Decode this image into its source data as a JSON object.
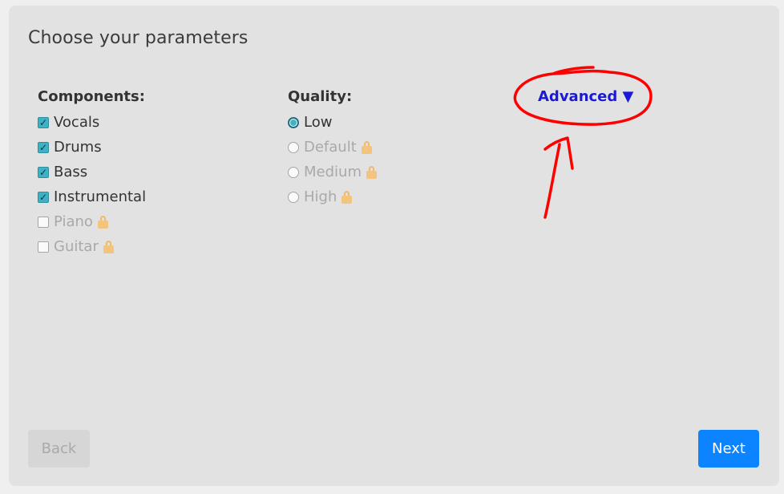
{
  "title": "Choose your parameters",
  "components": {
    "heading": "Components:",
    "items": [
      {
        "label": "Vocals",
        "checked": true,
        "locked": false
      },
      {
        "label": "Drums",
        "checked": true,
        "locked": false
      },
      {
        "label": "Bass",
        "checked": true,
        "locked": false
      },
      {
        "label": "Instrumental",
        "checked": true,
        "locked": false
      },
      {
        "label": "Piano",
        "checked": false,
        "locked": true
      },
      {
        "label": "Guitar",
        "checked": false,
        "locked": true
      }
    ]
  },
  "quality": {
    "heading": "Quality:",
    "items": [
      {
        "label": "Low",
        "selected": true,
        "locked": false
      },
      {
        "label": "Default",
        "selected": false,
        "locked": true
      },
      {
        "label": "Medium",
        "selected": false,
        "locked": true
      },
      {
        "label": "High",
        "selected": false,
        "locked": true
      }
    ]
  },
  "advanced": {
    "label": "Advanced ▼"
  },
  "buttons": {
    "back": "Back",
    "next": "Next"
  },
  "colors": {
    "accent": "#0d84ff",
    "advanced": "#1a1ad6",
    "annotation": "#ff0000",
    "checkbox": "#3fb1c4",
    "lock": "#f3c47b"
  },
  "icons": {
    "lock": "lock-icon",
    "check": "checkmark-icon"
  }
}
